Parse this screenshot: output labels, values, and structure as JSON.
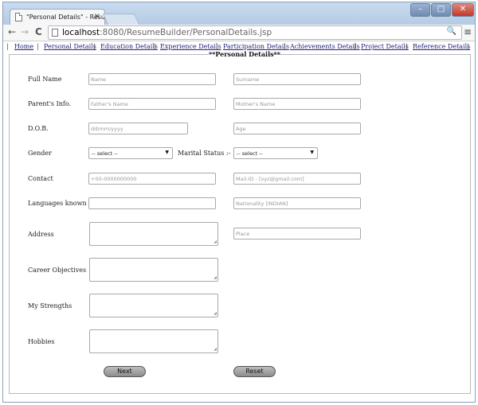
{
  "browser": {
    "tab_title": "\"Personal Details\" - Resu",
    "tab_close": "×",
    "url_host": "localhost",
    "url_rest": ":8080/ResumeBuilder/PersonalDetails.jsp",
    "back": "←",
    "forward": "→",
    "reload": "C",
    "search_glyph": "🔍",
    "menu_glyph": "≡",
    "window_controls": {
      "minimize": "–",
      "maximize": "□",
      "close": "✕"
    }
  },
  "nav": {
    "separator": "|",
    "links": [
      {
        "label": "Home"
      },
      {
        "label": "Personal Details"
      },
      {
        "label": "Education Details"
      },
      {
        "label": "Experience Details"
      },
      {
        "label": "Participation Details"
      },
      {
        "label": "Achievements Details"
      },
      {
        "label": "Project Details"
      },
      {
        "label": "Reference Details"
      }
    ]
  },
  "form": {
    "legend": "**Personal Details**",
    "labels": {
      "full_name": "Full Name",
      "parents": "Parent's Info.",
      "dob": "D.O.B.",
      "gender": "Gender",
      "marital": "Marital Status :-",
      "contact": "Contact",
      "languages": "Languages known",
      "address": "Address",
      "career": "Career Objectives",
      "strengths": "My Strengths",
      "hobbies": "Hobbies"
    },
    "placeholders": {
      "name": "Name",
      "surname": "Surname",
      "father": "Father's Name",
      "mother": "Mother's Name",
      "dob": "dd/mm/yyyy",
      "age": "Age",
      "contact": "+00-0000000000",
      "email": "Mail-ID - [xyz@gmail.com]",
      "languages": "",
      "nationality": "Nationality [INDIAN]",
      "place": "Place"
    },
    "selects": {
      "gender": "-- select --",
      "marital": "-- select --"
    },
    "buttons": {
      "next": "Next",
      "reset": "Reset"
    }
  },
  "colors": {
    "link": "#222277",
    "frame": "#b9b9b9",
    "button": "#a5a5a5"
  }
}
